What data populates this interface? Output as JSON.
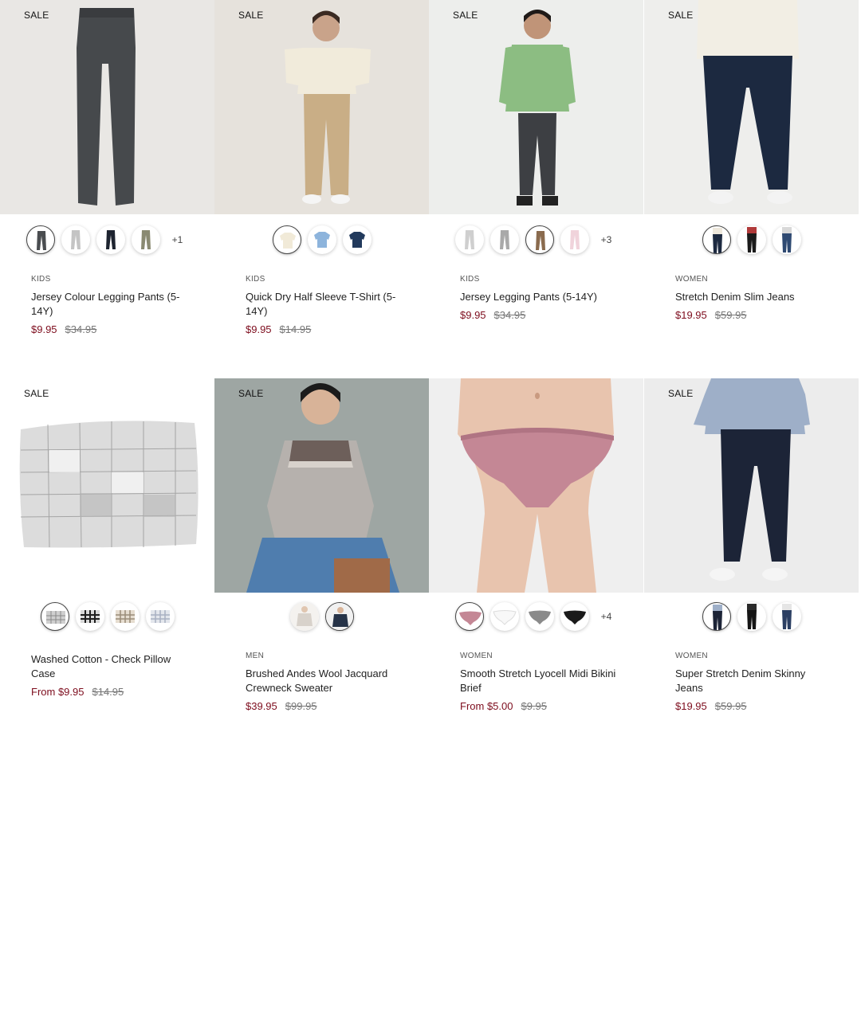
{
  "products": [
    {
      "badge": "SALE",
      "category": "KIDS",
      "name": "Jersey Colour Legging Pants (5-14Y)",
      "price": "$9.95",
      "original_price": "$34.95",
      "more_colors": "+1",
      "swatches": [
        "charcoal-pants",
        "light-grey-pants",
        "navy-pants",
        "khaki-pants"
      ]
    },
    {
      "badge": "SALE",
      "category": "KIDS",
      "name": "Quick Dry Half Sleeve T-Shirt (5-14Y)",
      "price": "$9.95",
      "original_price": "$14.95",
      "more_colors": "",
      "swatches": [
        "ecru-tshirt",
        "light-blue-tshirt",
        "navy-tshirt"
      ]
    },
    {
      "badge": "SALE",
      "category": "KIDS",
      "name": "Jersey Legging Pants (5-14Y)",
      "price": "$9.95",
      "original_price": "$34.95",
      "more_colors": "+3",
      "swatches": [
        "light-grey-pants",
        "grey-pants",
        "brown-pants",
        "pink-pants"
      ]
    },
    {
      "badge": "SALE",
      "category": "WOMEN",
      "name": "Stretch Denim Slim Jeans",
      "price": "$19.95",
      "original_price": "$59.95",
      "more_colors": "",
      "swatches": [
        "navy-jeans-model",
        "black-jeans-model",
        "blue-jeans-model"
      ]
    },
    {
      "badge": "SALE",
      "category": "",
      "name": "Washed Cotton - Check Pillow Case",
      "price": "From $9.95",
      "original_price": "$14.95",
      "more_colors": "",
      "swatches": [
        "grey-check-pillow",
        "black-check-pillow",
        "beige-check-pillow",
        "blue-check-pillow"
      ]
    },
    {
      "badge": "SALE",
      "category": "MEN",
      "name": "Brushed Andes Wool Jacquard Crewneck Sweater",
      "price": "$39.95",
      "original_price": "$99.95",
      "more_colors": "",
      "swatches": [
        "oatmeal-sweater-model",
        "navy-sweater-model"
      ]
    },
    {
      "badge": "",
      "category": "WOMEN",
      "name": "Smooth Stretch Lyocell Midi Bikini Brief",
      "price": "From $5.00",
      "original_price": "$9.95",
      "more_colors": "+4",
      "swatches": [
        "pink-brief",
        "white-brief",
        "grey-brief",
        "black-brief"
      ]
    },
    {
      "badge": "SALE",
      "category": "WOMEN",
      "name": "Super Stretch Denim Skinny Jeans",
      "price": "$19.95",
      "original_price": "$59.95",
      "more_colors": "",
      "swatches": [
        "navy-skinny-model",
        "black-skinny-model",
        "blue-skinny-model"
      ]
    }
  ],
  "colors": {
    "sale_price": "#7d0c1d",
    "strike_price": "#777777",
    "badge": "#111111"
  }
}
